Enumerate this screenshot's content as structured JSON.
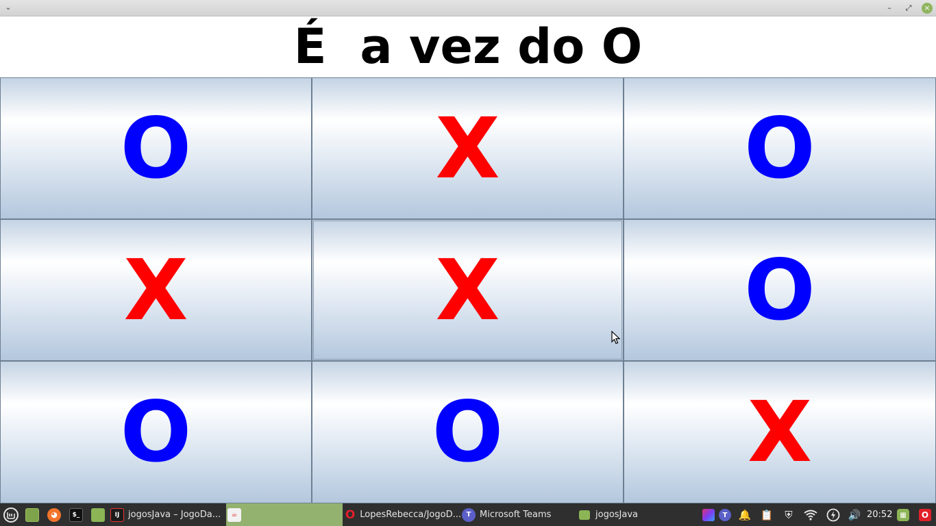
{
  "window": {
    "menu_glyph": "⌄",
    "min_glyph": "–",
    "max_glyph": "⤢",
    "close_glyph": "×"
  },
  "heading": "É  a vez do O",
  "board": {
    "cells": [
      "O",
      "X",
      "O",
      "X",
      "X",
      "O",
      "O",
      "O",
      "X"
    ],
    "focused_index": 4,
    "colors": {
      "X": "#ff0000",
      "O": "#0000ff"
    }
  },
  "taskbar": {
    "tasks": [
      {
        "label": "jogosJava – JogoDa...",
        "icon": "intellij-icon"
      },
      {
        "label": "",
        "icon": "java-app-icon",
        "active": true
      },
      {
        "label": "LopesRebecca/JogoD...",
        "icon": "opera-icon"
      },
      {
        "label": "Microsoft Teams",
        "icon": "teams-icon"
      },
      {
        "label": "jogosJava",
        "icon": "folder-icon"
      }
    ],
    "clock": "20:52"
  }
}
